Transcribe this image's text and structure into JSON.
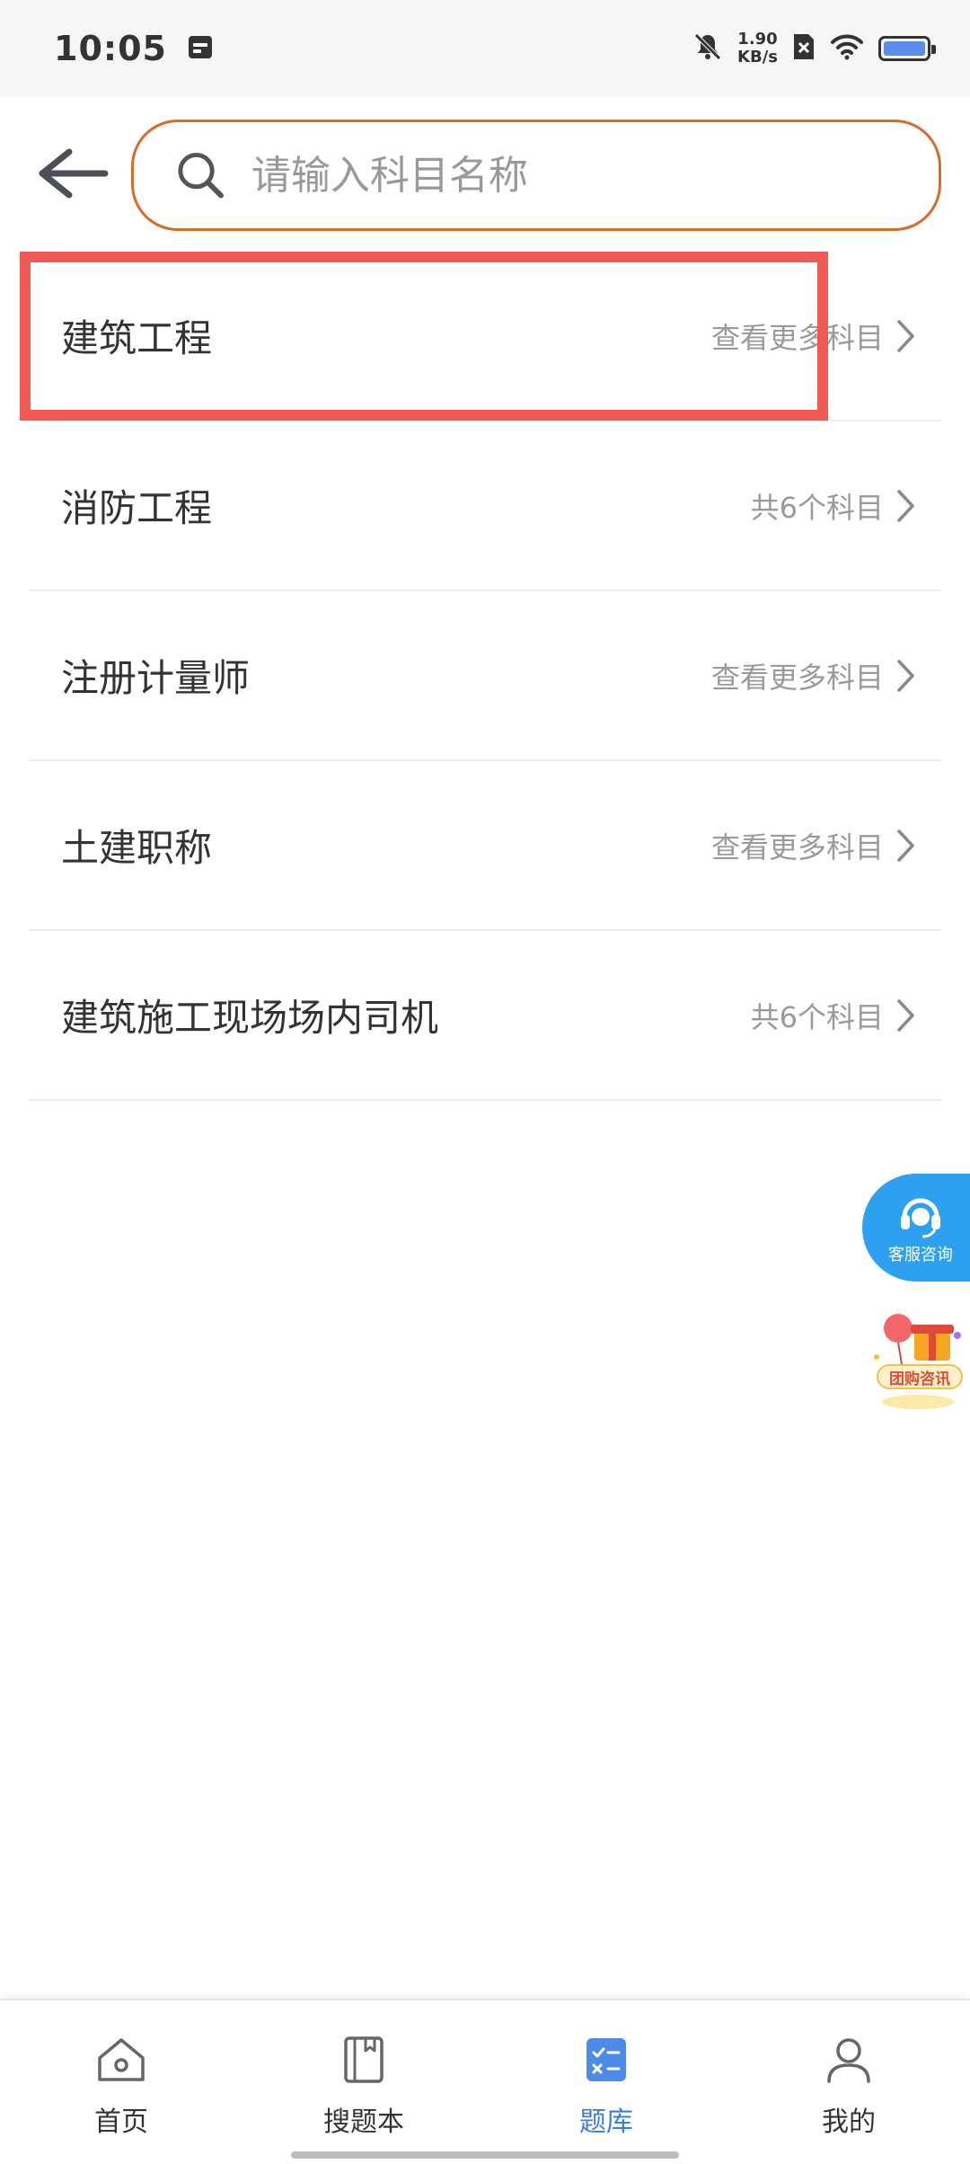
{
  "status_bar": {
    "time": "10:05",
    "net_speed_value": "1.90",
    "net_speed_unit": "KB/s",
    "battery_level": 1.0
  },
  "search": {
    "placeholder": "请输入科目名称"
  },
  "list": [
    {
      "title": "建筑工程",
      "hint": "查看更多科目",
      "highlighted": true
    },
    {
      "title": "消防工程",
      "hint": "共6个科目",
      "highlighted": false
    },
    {
      "title": "注册计量师",
      "hint": "查看更多科目",
      "highlighted": false
    },
    {
      "title": "土建职称",
      "hint": "查看更多科目",
      "highlighted": false
    },
    {
      "title": "建筑施工现场场内司机",
      "hint": "共6个科目",
      "highlighted": false
    }
  ],
  "floating": {
    "service_label": "客服咨询",
    "group_label": "团购咨讯"
  },
  "tabbar": {
    "tabs": [
      {
        "label": "首页",
        "icon": "home-icon",
        "active": false
      },
      {
        "label": "搜题本",
        "icon": "bookmark-book-icon",
        "active": false
      },
      {
        "label": "题库",
        "icon": "question-bank-icon",
        "active": true
      },
      {
        "label": "我的",
        "icon": "profile-icon",
        "active": false
      }
    ]
  },
  "colors": {
    "accent": "#3c7de0",
    "search_border": "#d86a2a",
    "highlight": "#ef5a55",
    "service_button": "#2ea0f0"
  }
}
